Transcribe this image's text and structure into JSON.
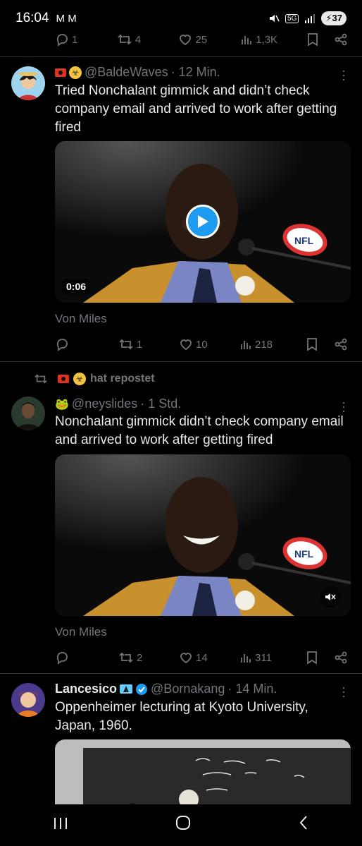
{
  "status_bar": {
    "time": "16:04",
    "notification_icons": "M M",
    "network": "5G",
    "battery": "37"
  },
  "top_actions": {
    "replies": "1",
    "reposts": "4",
    "likes": "25",
    "views": "1,3K"
  },
  "posts": [
    {
      "handle": "@BaldeWaves",
      "time": "· 12 Min.",
      "text": "Tried Nonchalant gimmick and didn’t check company email and arrived to work after getting fired",
      "media": {
        "duration": "0:06",
        "type": "video"
      },
      "source": "Von Miles",
      "actions": {
        "replies": "",
        "reposts": "1",
        "likes": "10",
        "views": "218"
      }
    },
    {
      "repost_label": "hat repostet",
      "handle": "@neyslides",
      "time": "· 1 Std.",
      "text": "Nonchalant gimmick didn’t check company email and arrived to work after getting fired",
      "media": {
        "type": "video"
      },
      "source": "Von Miles",
      "actions": {
        "replies": "",
        "reposts": "2",
        "likes": "14",
        "views": "311"
      }
    },
    {
      "name": "Lancesico",
      "handle": "@Bornakang",
      "time": "· 14 Min.",
      "text": "Oppenheimer lecturing at Kyoto University, Japan, 1960."
    }
  ],
  "colors": {
    "background": "#000000",
    "text": "#e7e9ea",
    "muted": "#71767b",
    "accent": "#1d9bf0",
    "divider": "#2f3336"
  },
  "icons": {
    "reply": "reply-icon",
    "repost": "repost-icon",
    "like": "like-icon",
    "views": "views-icon",
    "bookmark": "bookmark-icon",
    "share": "share-icon"
  }
}
